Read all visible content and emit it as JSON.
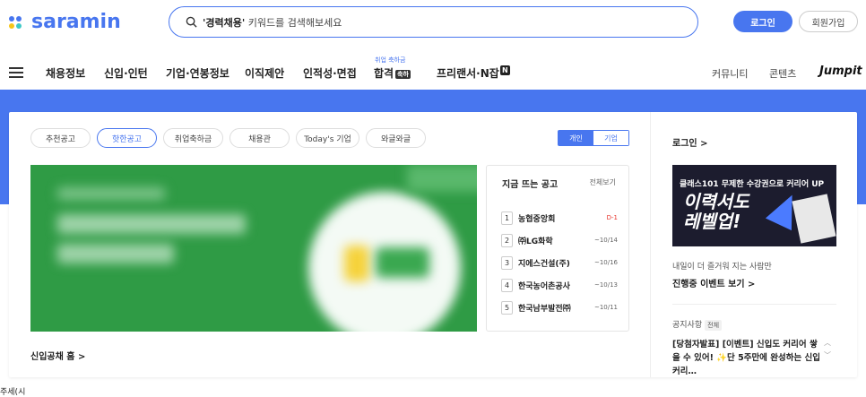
{
  "header": {
    "logo": "saramin",
    "search_placeholder_bold": "'경력채용'",
    "search_placeholder_rest": " 키워드를 검색해보세요",
    "login": "로그인",
    "join": "회원가입"
  },
  "gnb": {
    "items": [
      "채용정보",
      "신입·인턴",
      "기업·연봉정보",
      "이직제안",
      "인적성·면접",
      "합격",
      "프리랜서·N잡"
    ],
    "hapgyeok_sub": "취업 축하금",
    "hapgyeok_badge": "축하",
    "nzap_badge": "N",
    "right": [
      "커뮤니티",
      "콘텐츠"
    ],
    "jumpit": "Jumpit"
  },
  "tabs": [
    "추천공고",
    "핫한공고",
    "취업축하금",
    "채용관",
    "Today's 기업",
    "와글와글"
  ],
  "toggle": {
    "on": "개인",
    "off": "기업"
  },
  "hot": {
    "title": "지금 뜨는 공고",
    "more": "전체보기",
    "rows": [
      {
        "num": "1",
        "name": "농협중앙회",
        "date": "D-1"
      },
      {
        "num": "2",
        "name": "㈜LG화학",
        "date": "~10/14"
      },
      {
        "num": "3",
        "name": "지에스건설(주)",
        "date": "~10/16"
      },
      {
        "num": "4",
        "name": "한국농어촌공사",
        "date": "~10/13"
      },
      {
        "num": "5",
        "name": "한국남부발전㈜",
        "date": "~10/11"
      }
    ]
  },
  "gongchae": "신입공채 홈 >",
  "side": {
    "login": "로그인 >",
    "ad_top": "클래스101 무제한 수강권으로 커리어 UP",
    "ad_big1": "이력서도",
    "ad_big2": "레벨업!",
    "event_sub": "내일이 더 즐거워 지는 사람만",
    "event_main": "진행중 이벤트 보기 >",
    "notice_label": "공지사항",
    "notice_tag": "전체",
    "notice_text": "[당첨자발표] [이벤트] 신입도 커리어 쌓을 수 있어! ✨단 5주만에 완성하는 신입 커리…"
  },
  "bottom_text": "주세(시"
}
